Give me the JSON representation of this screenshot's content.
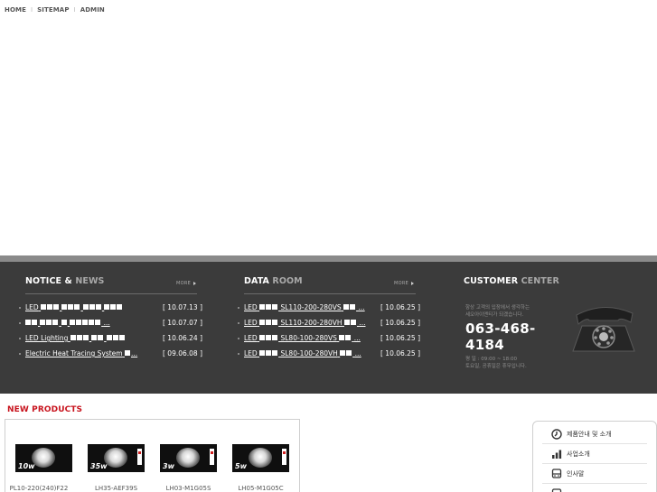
{
  "topnav": {
    "items": [
      {
        "label": "HOME"
      },
      {
        "label": "SITEMAP"
      },
      {
        "label": "ADMIN"
      }
    ]
  },
  "notice": {
    "title_main": "NOTICE & ",
    "title_hl": "NEWS",
    "more": "MORE",
    "items": [
      {
        "prefix": "LED",
        "suffix": "",
        "date": "[ 10.07.13 ]"
      },
      {
        "prefix": "",
        "suffix": "...",
        "date": "[ 10.07.07 ]"
      },
      {
        "prefix": "LED Lighting",
        "suffix": "",
        "date": "[ 10.06.24 ]"
      },
      {
        "prefix": "Electric Heat Tracing System",
        "suffix": "...",
        "date": "[ 09.06.08 ]"
      }
    ]
  },
  "dataroom": {
    "title_main": "DATA ",
    "title_hl": "ROOM",
    "more": "MORE",
    "items": [
      {
        "prefix": "LED",
        "model": "SL110-200-280VS",
        "suffix": "...",
        "date": "[ 10.06.25 ]"
      },
      {
        "prefix": "LED",
        "model": "SL110-200-280VH",
        "suffix": "...",
        "date": "[ 10.06.25 ]"
      },
      {
        "prefix": "LED",
        "model": "SL80-100-280VS",
        "suffix": "...",
        "date": "[ 10.06.25 ]"
      },
      {
        "prefix": "LED",
        "model": "SL80-100-280VH",
        "suffix": "...",
        "date": "[ 10.06.25 ]"
      }
    ]
  },
  "customer": {
    "title_main": "CUSTOMER ",
    "title_hl": "CENTER",
    "line1": "항상 고객의 입장에서 생각하는",
    "line2": "세오아이엔티가 되겠습니다.",
    "phone": "063-468-4184",
    "hours1": "평 일 : 09:00 ~ 18:00",
    "hours2": "토요일, 공휴일은 휴무입니다."
  },
  "new_products": {
    "title": "NEW PRODUCTS",
    "items": [
      {
        "watt": "10w",
        "name": "PL10-220(240)F22"
      },
      {
        "watt": "35w",
        "name": "LH35-AEF39S"
      },
      {
        "watt": "3w",
        "name": "LH03-M1G05S"
      },
      {
        "watt": "5w",
        "name": "LH05-M1G05C"
      }
    ]
  },
  "quick_menu": {
    "items": [
      {
        "label": "제품안내 및 소개"
      },
      {
        "label": "사업소개"
      },
      {
        "label": "인사말"
      }
    ]
  },
  "colors": {
    "band": "#3b3b3b",
    "accent_red": "#c8141e"
  }
}
